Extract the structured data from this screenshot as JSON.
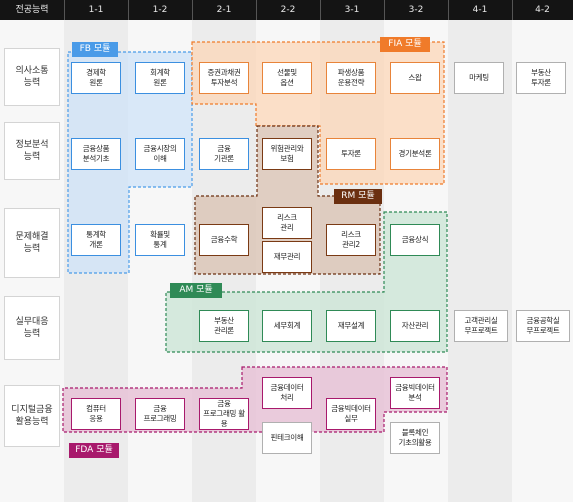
{
  "header": {
    "corner": "전공능력",
    "columns": [
      "1-1",
      "1-2",
      "2-1",
      "2-2",
      "3-1",
      "3-2",
      "4-1",
      "4-2"
    ]
  },
  "rows": [
    "의사소통\n능력",
    "정보분석\n능력",
    "문제해결\n능력",
    "실무대응\n능력",
    "디지털금융\n활용능력"
  ],
  "modules": {
    "fb": "FB 모듈",
    "fia": "FIA 모듈",
    "rm": "RM 모듈",
    "am": "AM 모듈",
    "fda": "FDA 모듈"
  },
  "courses": {
    "econ": "경제학\n원론",
    "acct": "회계학\n원론",
    "securities": "증권과채권\n투자분석",
    "futures": "선물및\n옵션",
    "derivatives": "파생상품\n운용전략",
    "swap": "스왑",
    "marketing": "마케팅",
    "realestate_invest": "부동산\n투자론",
    "fin_products": "금융상품\n분석기초",
    "fin_markets": "금융시장의\n이해",
    "fin_institutions": "금융\n기관론",
    "risk_insurance": "위험관리와\n보험",
    "investment": "투자론",
    "business_cycle": "경기분석론",
    "stats": "통계학\n개론",
    "probability": "확률및\n통계",
    "fin_math": "금융수학",
    "risk_mgmt": "리스크\n관리",
    "risk_mgmt2": "리스크\n관리2",
    "fin_common": "금융상식",
    "fin_law": "재무관리",
    "realestate_mgmt": "부동산\n관리론",
    "tax_acct": "세무회계",
    "fin_design": "재무설계",
    "asset_mgmt": "자산관리",
    "customer_project": "고객관리실\n무프로젝트",
    "fineng_project": "금융공학실\n무프로젝트",
    "computer": "컴퓨터\n응용",
    "fin_programming": "금융\n프로그래밍",
    "fin_prog_apply": "금융\n프로그래밍 활용",
    "fin_data": "금융데이터\n처리",
    "fintech": "핀테크이해",
    "bigdata_practice": "금융빅데이터\n실무",
    "bigdata_analysis": "금융빅데이터\n분석",
    "blockchain": "블록체인\n기초의활용"
  },
  "colors": {
    "header": "#141414",
    "fb": "#4a9be8",
    "fia": "#f07b2a",
    "rm": "#6b2f10",
    "am": "#2f8a56",
    "fda": "#a8196c"
  }
}
